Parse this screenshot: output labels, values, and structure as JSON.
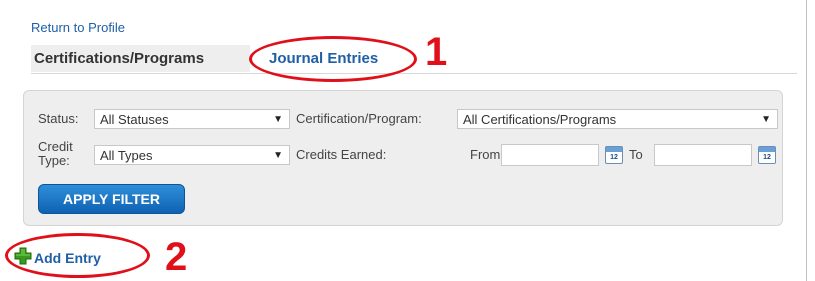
{
  "nav": {
    "return_link": "Return to Profile"
  },
  "tabs": [
    {
      "label": "Certifications/Programs",
      "active": false
    },
    {
      "label": "Journal Entries",
      "active": true
    }
  ],
  "filters": {
    "status_label": "Status:",
    "status_value": "All Statuses",
    "certification_label": "Certification/Program:",
    "certification_value": "All Certifications/Programs",
    "credit_type_label_line1": "Credit",
    "credit_type_label_line2": "Type:",
    "credit_type_value": "All Types",
    "credits_earned_label": "Credits Earned:",
    "from_label": "From",
    "to_label": "To",
    "from_value": "",
    "to_value": "",
    "calendar_glyph": "12",
    "apply_button": "APPLY FILTER"
  },
  "actions": {
    "add_entry": "Add Entry"
  },
  "annotations": {
    "marker_1": "1",
    "marker_2": "2",
    "color": "#e0101a"
  },
  "colors": {
    "link_blue": "#1f5fa6",
    "button_blue": "#1a72c4",
    "panel_bg": "#eeeeee",
    "plus_green": "#3a9a1f"
  }
}
